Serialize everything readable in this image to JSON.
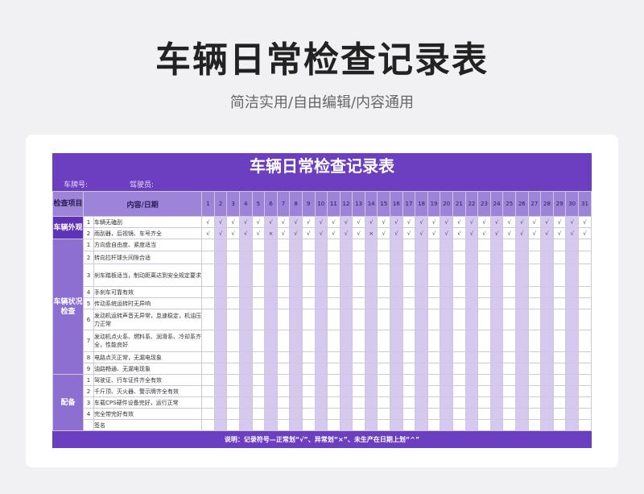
{
  "header": {
    "title": "车辆日常检查记录表",
    "subtitle": "简洁实用/自由编辑/内容通用"
  },
  "sheet": {
    "title": "车辆日常检查记录表",
    "plate_label": "车牌号:",
    "driver_label": "驾驶员:",
    "col_category": "检查项目",
    "col_content": "内容/日期",
    "days": [
      "1",
      "2",
      "3",
      "4",
      "5",
      "6",
      "7",
      "8",
      "9",
      "10",
      "11",
      "12",
      "13",
      "14",
      "15",
      "16",
      "17",
      "18",
      "19",
      "20",
      "21",
      "22",
      "23",
      "24",
      "25",
      "26",
      "27",
      "28",
      "29",
      "30",
      "31"
    ],
    "categories": [
      {
        "name": "车辆外观",
        "items": [
          {
            "num": "1",
            "text": "车辆无磕刮",
            "marks": [
              "√",
              "√",
              "√",
              "√",
              "√",
              "√",
              "√",
              "√",
              "√",
              "√",
              "√",
              "√",
              "√",
              "√",
              "√",
              "√",
              "√",
              "√",
              "√",
              "√",
              "√",
              "√",
              "√",
              "√",
              "√",
              "√",
              "√",
              "√",
              "√",
              "√",
              "√"
            ]
          },
          {
            "num": "2",
            "text": "雨刮器，后视镜、车号齐全",
            "marks": [
              "√",
              "√",
              "√",
              "√",
              "√",
              "×",
              "√",
              "√",
              "√",
              "√",
              "√",
              "√",
              "√",
              "×",
              "√",
              "√",
              "√",
              "√",
              "√",
              "√",
              "√",
              "√",
              "√",
              "√",
              "√",
              "√",
              "√",
              "√",
              "√",
              "√",
              "√"
            ]
          }
        ]
      },
      {
        "name": "车辆状况检查",
        "items": [
          {
            "num": "1",
            "text": "方向盘自由度、紧度适当"
          },
          {
            "num": "2",
            "text": "转向拉杆球头间隙合适"
          },
          {
            "num": "3",
            "text": "刹车踏板适当，制动距离达到安全规定要求"
          },
          {
            "num": "4",
            "text": "手刹车可靠有效"
          },
          {
            "num": "5",
            "text": "传动系统运转时无异响"
          },
          {
            "num": "6",
            "text": "发动机运转声音无异常，怠速稳定，机油压力正常"
          },
          {
            "num": "7",
            "text": "发动机点火系、燃料系、润滑系、冷却系齐全，性能良好"
          },
          {
            "num": "8",
            "text": "电路点灭正常，无漏电现象"
          },
          {
            "num": "9",
            "text": "油路畅通、无漏电现象"
          }
        ]
      },
      {
        "name": "配备",
        "items": [
          {
            "num": "1",
            "text": "驾驶证、行车证件齐全有效"
          },
          {
            "num": "2",
            "text": "千斤顶、灭火器、警示牌齐全有效"
          },
          {
            "num": "3",
            "text": "车载CPS硬件设备完好，运行正常"
          },
          {
            "num": "4",
            "text": "完全带完好有效"
          }
        ]
      }
    ],
    "sign_label": "签名",
    "footer_note": "说明：记录符号—正常划“√”、异常划“×”、未生产在日期上划“^”"
  },
  "colors": {
    "accent": "#6b3fbf",
    "header_band": "#9d84d9",
    "stripe": "#d6c9f0"
  }
}
